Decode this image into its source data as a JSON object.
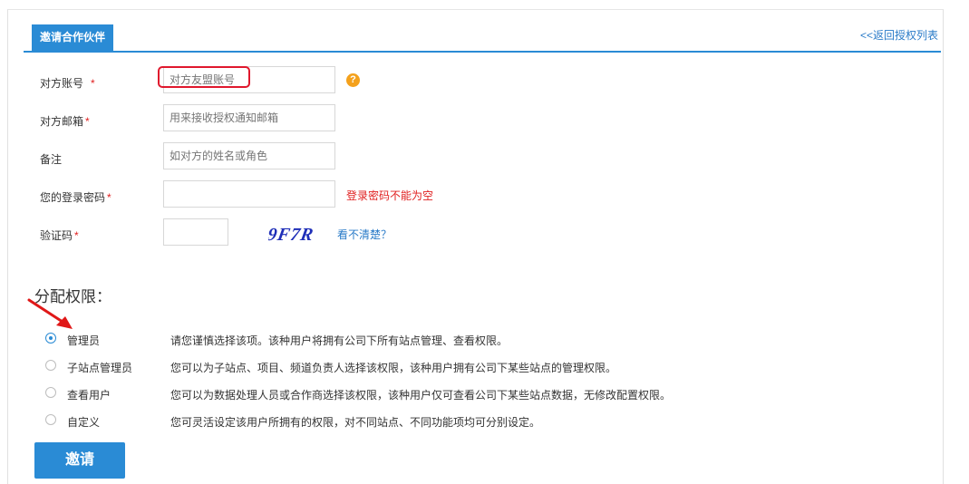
{
  "header": {
    "tab_label": "邀请合作伙伴",
    "back_link": "<<返回授权列表"
  },
  "form": {
    "account": {
      "label": "对方账号",
      "required_mark": "*",
      "placeholder": "对方友盟账号"
    },
    "email": {
      "label": "对方邮箱",
      "required_mark": "*",
      "placeholder": "用来接收授权通知邮箱"
    },
    "remark": {
      "label": "备注",
      "placeholder": "如对方的姓名或角色"
    },
    "password": {
      "label": "您的登录密码",
      "required_mark": "*",
      "value": "",
      "error": "登录密码不能为空"
    },
    "captcha": {
      "label": "验证码",
      "required_mark": "*",
      "value": "",
      "image_text": "9F7R",
      "refresh_link": "看不清楚？"
    },
    "help_icon": "?"
  },
  "permissions": {
    "title": "分配权限：",
    "options": [
      {
        "name": "管理员",
        "description": "请您谨慎选择该项。该种用户将拥有公司下所有站点管理、查看权限。",
        "selected": true
      },
      {
        "name": "子站点管理员",
        "description": "您可以为子站点、项目、频道负责人选择该权限，该种用户拥有公司下某些站点的管理权限。",
        "selected": false
      },
      {
        "name": "查看用户",
        "description": "您可以为数据处理人员或合作商选择该权限，该种用户仅可查看公司下某些站点数据，无修改配置权限。",
        "selected": false
      },
      {
        "name": "自定义",
        "description": "您可灵活设定该用户所拥有的权限，对不同站点、不同功能项均可分别设定。",
        "selected": false
      }
    ]
  },
  "actions": {
    "invite_label": "邀请"
  },
  "colors": {
    "accent": "#2a8bd5",
    "error": "#e01f1f",
    "highlight": "#e0182d",
    "help": "#f4a11c"
  }
}
